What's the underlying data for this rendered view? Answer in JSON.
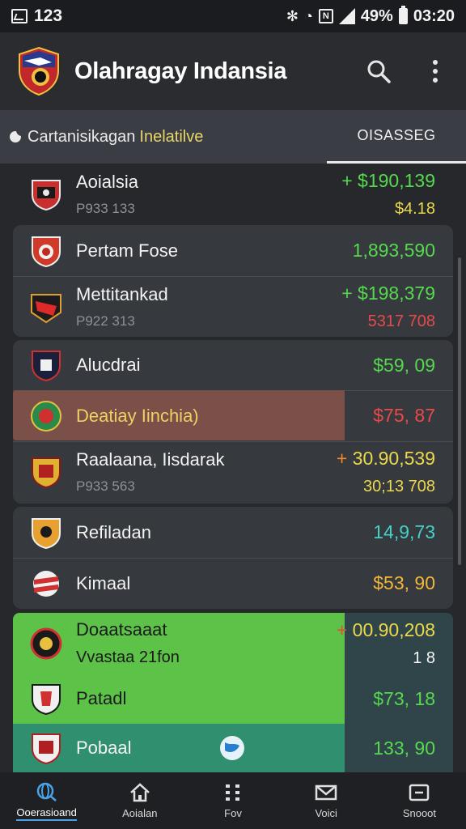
{
  "status_bar": {
    "notification_count": "123",
    "battery": "49%",
    "time": "03:20"
  },
  "app": {
    "title": "Olahragay Indansia",
    "logo": "club-crest-logo"
  },
  "tabs": {
    "main_label": "Cartanisikagan",
    "main_highlight": "Inelatilve",
    "side_label": "OISASSEG"
  },
  "rows": [
    {
      "name": "Aoialsia",
      "sub": "P933 133",
      "value": "+ $190,139",
      "value2": "$4.18"
    },
    {
      "name": "Pertam Fose",
      "value": "1,893,590"
    },
    {
      "name": "Mettitankad",
      "sub": "P922 313",
      "value": "+ $198,379",
      "value2": "5317 708"
    },
    {
      "name": "Alucdrai",
      "value": "$59, 09"
    },
    {
      "name": "Deatiay Iinchia)",
      "value": "$75, 87"
    },
    {
      "name": "Raalaana, Iisdarak",
      "sub": "P933 563",
      "value_prefix": "+",
      "value": "30.90,539",
      "value2": "30;13 708"
    },
    {
      "name": "Refiladan",
      "value": "14,9,73"
    },
    {
      "name": "Kimaal",
      "value": "$53, 90"
    },
    {
      "name": "Doaatsaaat",
      "sub": "Vvastaa 21fon",
      "value_prefix": "+",
      "value": "00.90,208",
      "value2": "1 8"
    },
    {
      "name": "Patadl",
      "value": "$73, 18"
    },
    {
      "name": "Pobaal",
      "value": "133, 90"
    }
  ],
  "nav": [
    {
      "label": "Ooerasioand",
      "icon": "globe-icon"
    },
    {
      "label": "Aoialan",
      "icon": "home-icon"
    },
    {
      "label": "Fov",
      "icon": "grid-icon"
    },
    {
      "label": "Voici",
      "icon": "mail-icon"
    },
    {
      "label": "Snooot",
      "icon": "inbox-icon"
    }
  ],
  "colors": {
    "background": "#26282c",
    "card": "#36393e",
    "positive": "#56d94e",
    "accent_yellow": "#ecd84c",
    "negative": "#e84a4a",
    "highlight_brown": "#7a5048",
    "highlight_green": "#5cc248",
    "highlight_teal": "#2f8f6e",
    "nav_active": "#4aa3e8"
  }
}
